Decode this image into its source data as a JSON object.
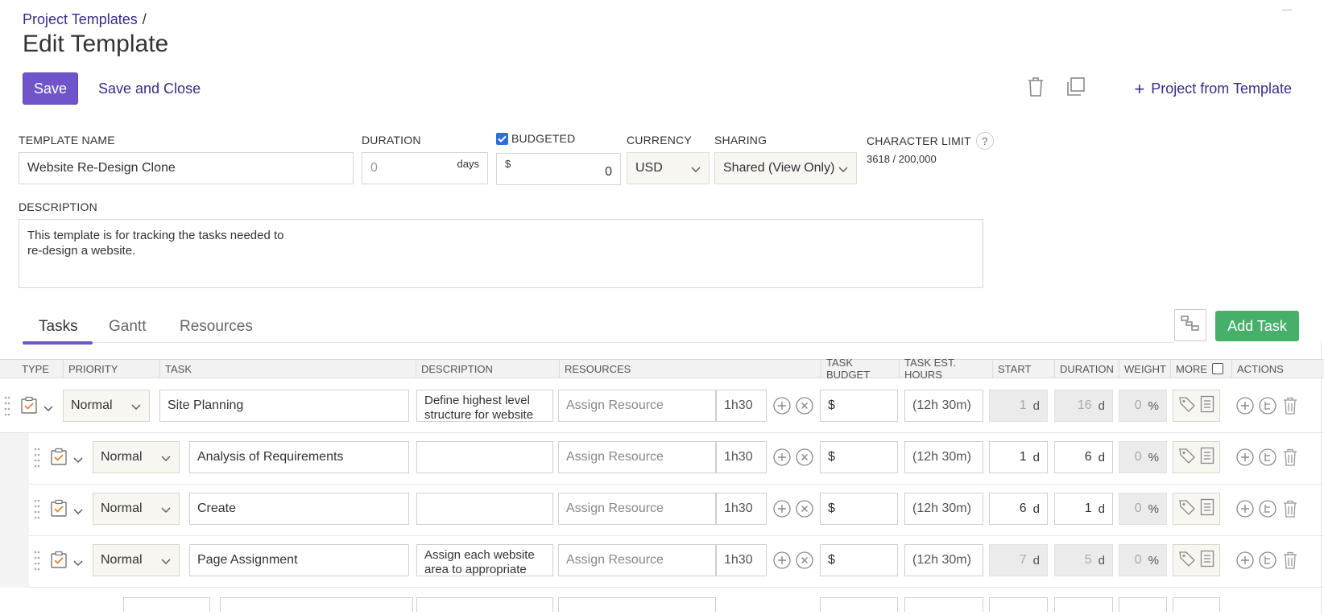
{
  "header": {
    "breadcrumb": "Project Templates",
    "breadcrumb_sep": "/",
    "title": "Edit Template",
    "save_label": "Save",
    "save_close_label": "Save and Close",
    "project_from_template_label": "Project from Template"
  },
  "form": {
    "template_name_label": "TEMPLATE NAME",
    "template_name_value": "Website Re-Design Clone",
    "duration_label": "DURATION",
    "duration_placeholder": "0",
    "duration_unit": "days",
    "budgeted_label": "BUDGETED",
    "budgeted_checked": true,
    "budget_currency_symbol": "$",
    "budget_value": "0",
    "currency_label": "CURRENCY",
    "currency_value": "USD",
    "sharing_label": "SHARING",
    "sharing_value": "Shared (View Only)",
    "char_limit_label": "CHARACTER LIMIT",
    "char_limit_help": "?",
    "char_limit_value": "3618 / 200,000",
    "description_label": "DESCRIPTION",
    "description_value": "This template is for tracking the tasks needed to\nre-design a website."
  },
  "tabs": [
    {
      "label": "Tasks",
      "active": true
    },
    {
      "label": "Gantt",
      "active": false
    },
    {
      "label": "Resources",
      "active": false
    }
  ],
  "add_task_label": "Add Task",
  "table": {
    "headers": [
      "TYPE",
      "PRIORITY",
      "TASK",
      "DESCRIPTION",
      "RESOURCES",
      "TASK BUDGET",
      "TASK EST. HOURS",
      "START",
      "DURATION",
      "WEIGHT",
      "MORE",
      "ACTIONS"
    ],
    "rows": [
      {
        "priority": "Normal",
        "task": "Site Planning",
        "description": "Define highest level structure for website",
        "resource_placeholder": "Assign Resource",
        "hours": "1h30",
        "budget_symbol": "$",
        "est_hours": "(12h 30m)",
        "start": "1",
        "duration": "16",
        "weight": "0",
        "day_unit": "d",
        "pct_unit": "%"
      },
      {
        "priority": "Normal",
        "task": "Analysis of Requirements",
        "description": "",
        "resource_placeholder": "Assign Resource",
        "hours": "1h30",
        "budget_symbol": "$",
        "est_hours": "(12h 30m)",
        "start": "1",
        "duration": "6",
        "weight": "0",
        "day_unit": "d",
        "pct_unit": "%"
      },
      {
        "priority": "Normal",
        "task": "Create",
        "description": "",
        "resource_placeholder": "Assign Resource",
        "hours": "1h30",
        "budget_symbol": "$",
        "est_hours": "(12h 30m)",
        "start": "6",
        "duration": "1",
        "weight": "0",
        "day_unit": "d",
        "pct_unit": "%"
      },
      {
        "priority": "Normal",
        "task": "Page Assignment",
        "description": "Assign each website area to appropriate",
        "resource_placeholder": "Assign Resource",
        "hours": "1h30",
        "budget_symbol": "$",
        "est_hours": "(12h 30m)",
        "start": "7",
        "duration": "5",
        "weight": "0",
        "day_unit": "d",
        "pct_unit": "%"
      }
    ]
  },
  "colors": {
    "accent": "#6f55c9",
    "link": "#3a2b8c",
    "add_task": "#46b06a",
    "task_type_icon": "#e8832a"
  }
}
